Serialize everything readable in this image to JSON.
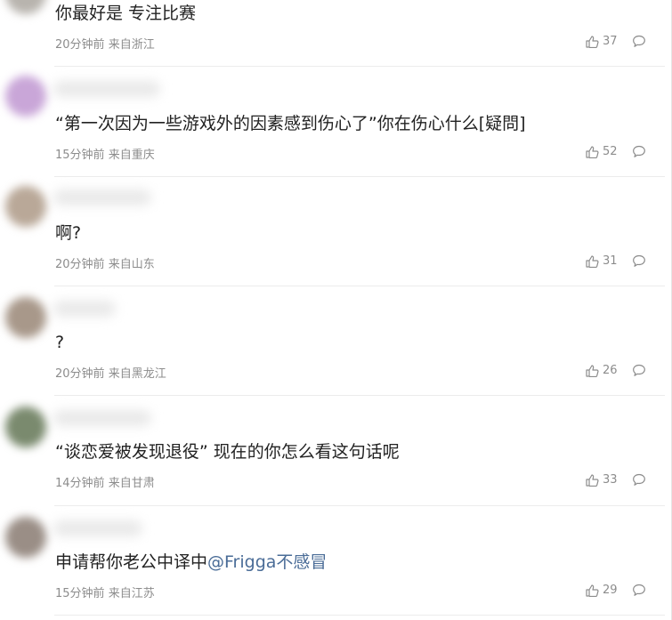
{
  "comments": [
    {
      "text": "你最好是 专注比赛",
      "time": "20分钟前",
      "location": "来自浙江",
      "likes": "37",
      "avatar_color": "#b8b4ae"
    },
    {
      "text": "“第一次因为一些游戏外的因素感到伤心了”你在伤心什么[疑問]",
      "time": "15分钟前",
      "location": "来自重庆",
      "likes": "52",
      "avatar_color": "#c9a6d8"
    },
    {
      "text": "啊?",
      "time": "20分钟前",
      "location": "来自山东",
      "likes": "31",
      "avatar_color": "#b9a898"
    },
    {
      "text": "?",
      "time": "20分钟前",
      "location": "来自黑龙江",
      "likes": "26",
      "avatar_color": "#a8988a"
    },
    {
      "text": "“谈恋爱被发现退役” 现在的你怎么看这句话呢",
      "time": "14分钟前",
      "location": "来自甘肃",
      "likes": "33",
      "avatar_color": "#7a8a6e"
    },
    {
      "text": "申请帮你老公中译中",
      "mention": "@Frigga不感冒",
      "time": "15分钟前",
      "location": "来自江苏",
      "likes": "29",
      "avatar_color": "#9a8e86"
    }
  ]
}
